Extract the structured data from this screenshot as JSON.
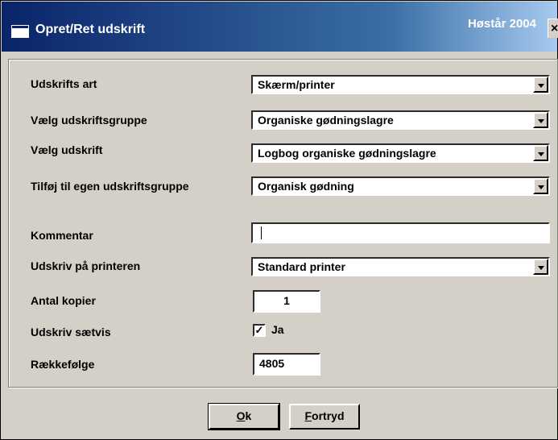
{
  "window": {
    "title": "Opret/Ret udskrift",
    "season": "Høstår 2004",
    "close_glyph": "×"
  },
  "form": {
    "udskrifts_art": {
      "label": "Udskrifts art",
      "value": "Skærm/printer"
    },
    "udskriftsgruppe": {
      "label": "Vælg udskriftsgruppe",
      "value": "Organiske gødningslagre"
    },
    "udskrift": {
      "label": "Vælg udskrift",
      "value": "Logbog organiske gødningslagre"
    },
    "egen_gruppe": {
      "label": "Tilføj til egen udskriftsgruppe",
      "value": "Organisk gødning"
    },
    "kommentar": {
      "label": "Kommentar",
      "value": ""
    },
    "printer": {
      "label": "Udskriv på printeren",
      "value": "Standard printer"
    },
    "kopier": {
      "label": "Antal kopier",
      "value": "1"
    },
    "saetvis": {
      "label": "Udskriv sætvis",
      "checked_glyph": "✓",
      "check_label": "Ja"
    },
    "raekkefolge": {
      "label": "Rækkefølge",
      "value": "4805"
    }
  },
  "buttons": {
    "ok": {
      "mnemonic": "O",
      "rest": "k"
    },
    "fortryd": {
      "mnemonic": "F",
      "rest": "ortryd"
    }
  }
}
